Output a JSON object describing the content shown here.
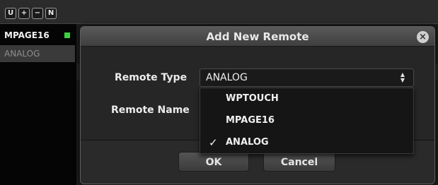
{
  "toolbar": {
    "buttons": [
      {
        "label": "U"
      },
      {
        "label": "+"
      },
      {
        "label": "−"
      },
      {
        "label": "N"
      }
    ]
  },
  "remotes_list": {
    "items": [
      {
        "label": "MPAGE16",
        "status_color": "#3bd33b"
      },
      {
        "label": "ANALOG"
      }
    ]
  },
  "dialog": {
    "title": "Add New Remote",
    "close_icon": "close-circle-icon",
    "remote_type_label": "Remote Type",
    "remote_name_label": "Remote Name",
    "remote_type_value": "ANALOG",
    "remote_type_options": [
      {
        "label": "WPTOUCH",
        "checked": false
      },
      {
        "label": "MPAGE16",
        "checked": false
      },
      {
        "label": "ANALOG",
        "checked": true
      }
    ],
    "checkmark": "✓",
    "ok_label": "OK",
    "cancel_label": "Cancel"
  }
}
